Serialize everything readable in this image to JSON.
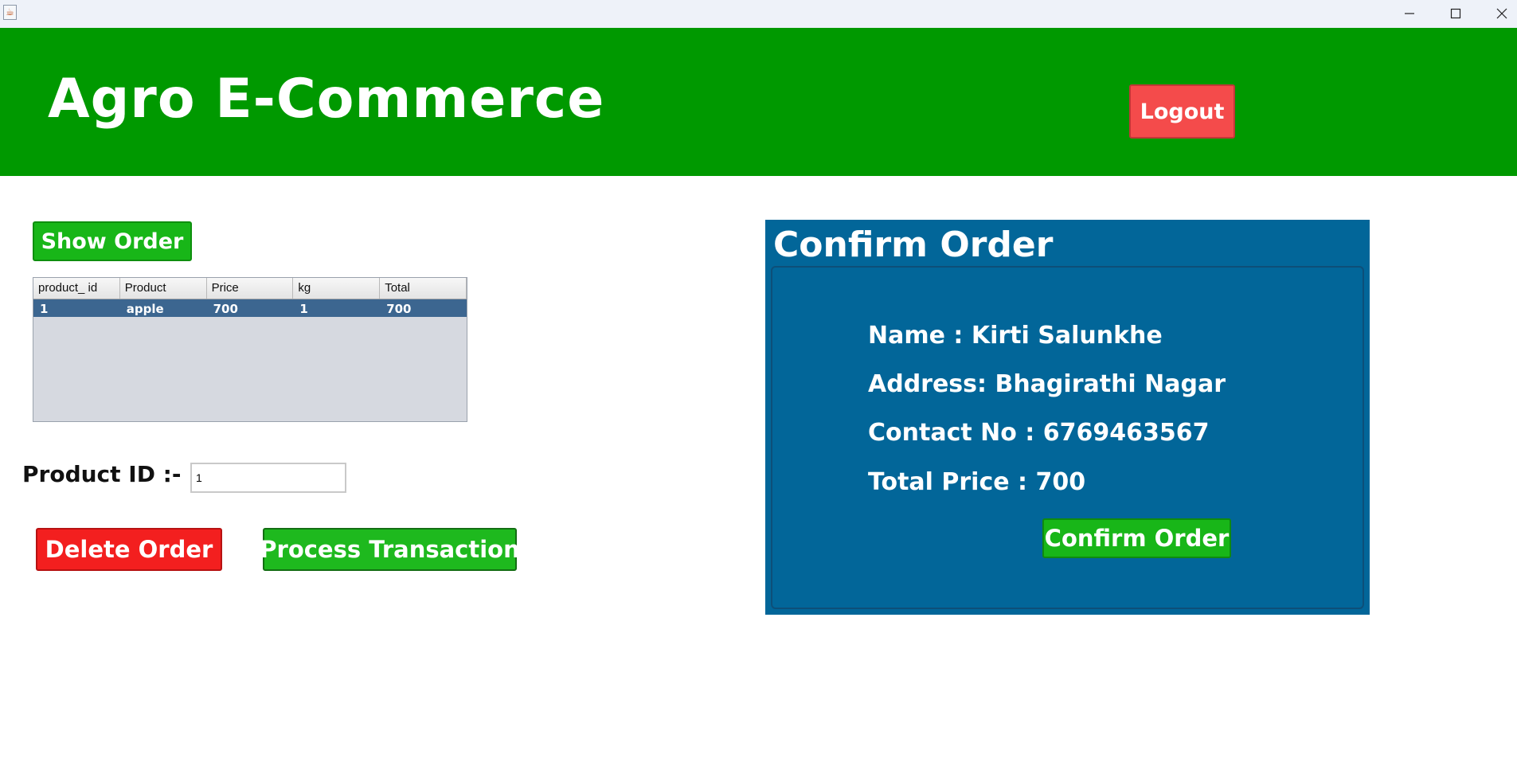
{
  "window": {
    "app_icon": "java-cup-icon",
    "minimize_glyph": "—",
    "maximize_glyph": "☐",
    "close_glyph": "✕"
  },
  "header": {
    "title": "Agro E-Commerce",
    "logout_label": "Logout"
  },
  "orders": {
    "show_order_label": "Show Order",
    "columns": [
      "product_ id",
      "Product",
      "Price",
      "kg",
      "Total"
    ],
    "rows": [
      [
        "1",
        "apple",
        "700",
        "1",
        "700"
      ]
    ]
  },
  "product_id": {
    "label": "Product ID :-",
    "value": "1"
  },
  "actions": {
    "delete_label": "Delete Order",
    "process_label": "Process Transaction"
  },
  "confirm": {
    "title": "Confirm Order",
    "name_line": "Name : Kirti Salunkhe",
    "address_line": "Address: Bhagirathi Nagar",
    "contact_line": "Contact No : 6769463567",
    "total_line": "Total Price : 700",
    "button_label": "Confirm Order"
  },
  "colors": {
    "header_green": "#009900",
    "panel_blue": "#026699",
    "danger_red": "#f31f1f",
    "action_green": "#18b618",
    "selected_row": "#3c6690"
  }
}
